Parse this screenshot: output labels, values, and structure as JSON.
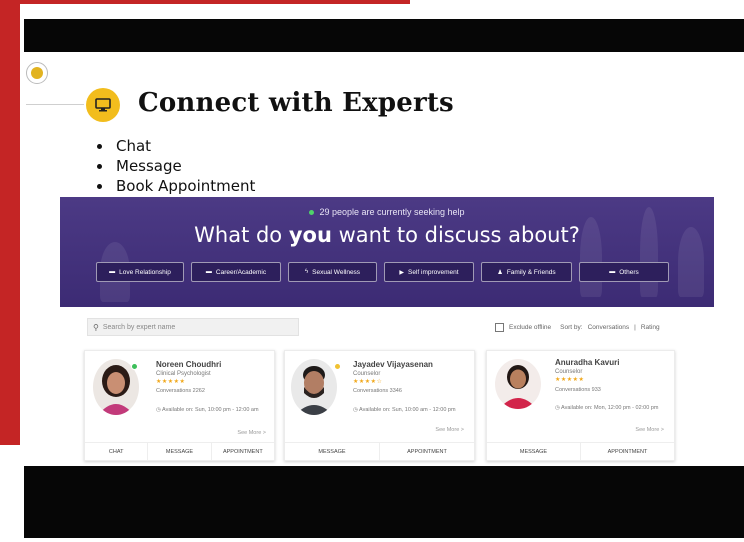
{
  "slide": {
    "title": "Connect with Experts",
    "bullets": [
      "Chat",
      "Message",
      "Book Appointment"
    ]
  },
  "banner": {
    "seeking_text": "29 people are currently seeking help",
    "headline_pre": "What do ",
    "headline_bold": "you",
    "headline_post": " want to discuss about?",
    "categories": [
      {
        "label": "Love Relationship",
        "icon": "heart-icon"
      },
      {
        "label": "Career/Academic",
        "icon": "briefcase-icon"
      },
      {
        "label": "Sexual Wellness",
        "icon": "wellness-icon"
      },
      {
        "label": "Self improvement",
        "icon": "flag-icon"
      },
      {
        "label": "Family & Friends",
        "icon": "people-icon"
      },
      {
        "label": "Others",
        "icon": "chat-icon"
      }
    ]
  },
  "search": {
    "placeholder": "Search by expert name"
  },
  "filters": {
    "exclude_offline": "Exclude offline",
    "sort_by": "Sort by:",
    "sort_conversations": "Conversations",
    "separator": "|",
    "sort_rating": "Rating"
  },
  "experts": [
    {
      "name": "Noreen Choudhri",
      "role": "Clinical Psychologist",
      "stars": "★★★★★",
      "conversations": "Conversations 2262",
      "availability": "Available on: Sun, 10:00 pm - 12:00 am",
      "see_more": "See More >",
      "actions": [
        "CHAT",
        "MESSAGE",
        "APPOINTMENT"
      ],
      "status_color": "#3cbf5a"
    },
    {
      "name": "Jayadev Vijayasenan",
      "role": "Counselor",
      "stars": "★★★★☆",
      "conversations": "Conversations 3346",
      "availability": "Available on: Sun, 10:00 am - 12:00 pm",
      "see_more": "See More >",
      "actions": [
        "MESSAGE",
        "APPOINTMENT"
      ],
      "status_color": "#f1c232"
    },
    {
      "name": "Anuradha Kavuri",
      "role": "Counselor",
      "stars": "★★★★★",
      "conversations": "Conversations 933",
      "availability": "Available on: Mon, 12:00 pm - 02:00 pm",
      "see_more": "See More >",
      "actions": [
        "MESSAGE",
        "APPOINTMENT"
      ],
      "status_color": ""
    }
  ]
}
